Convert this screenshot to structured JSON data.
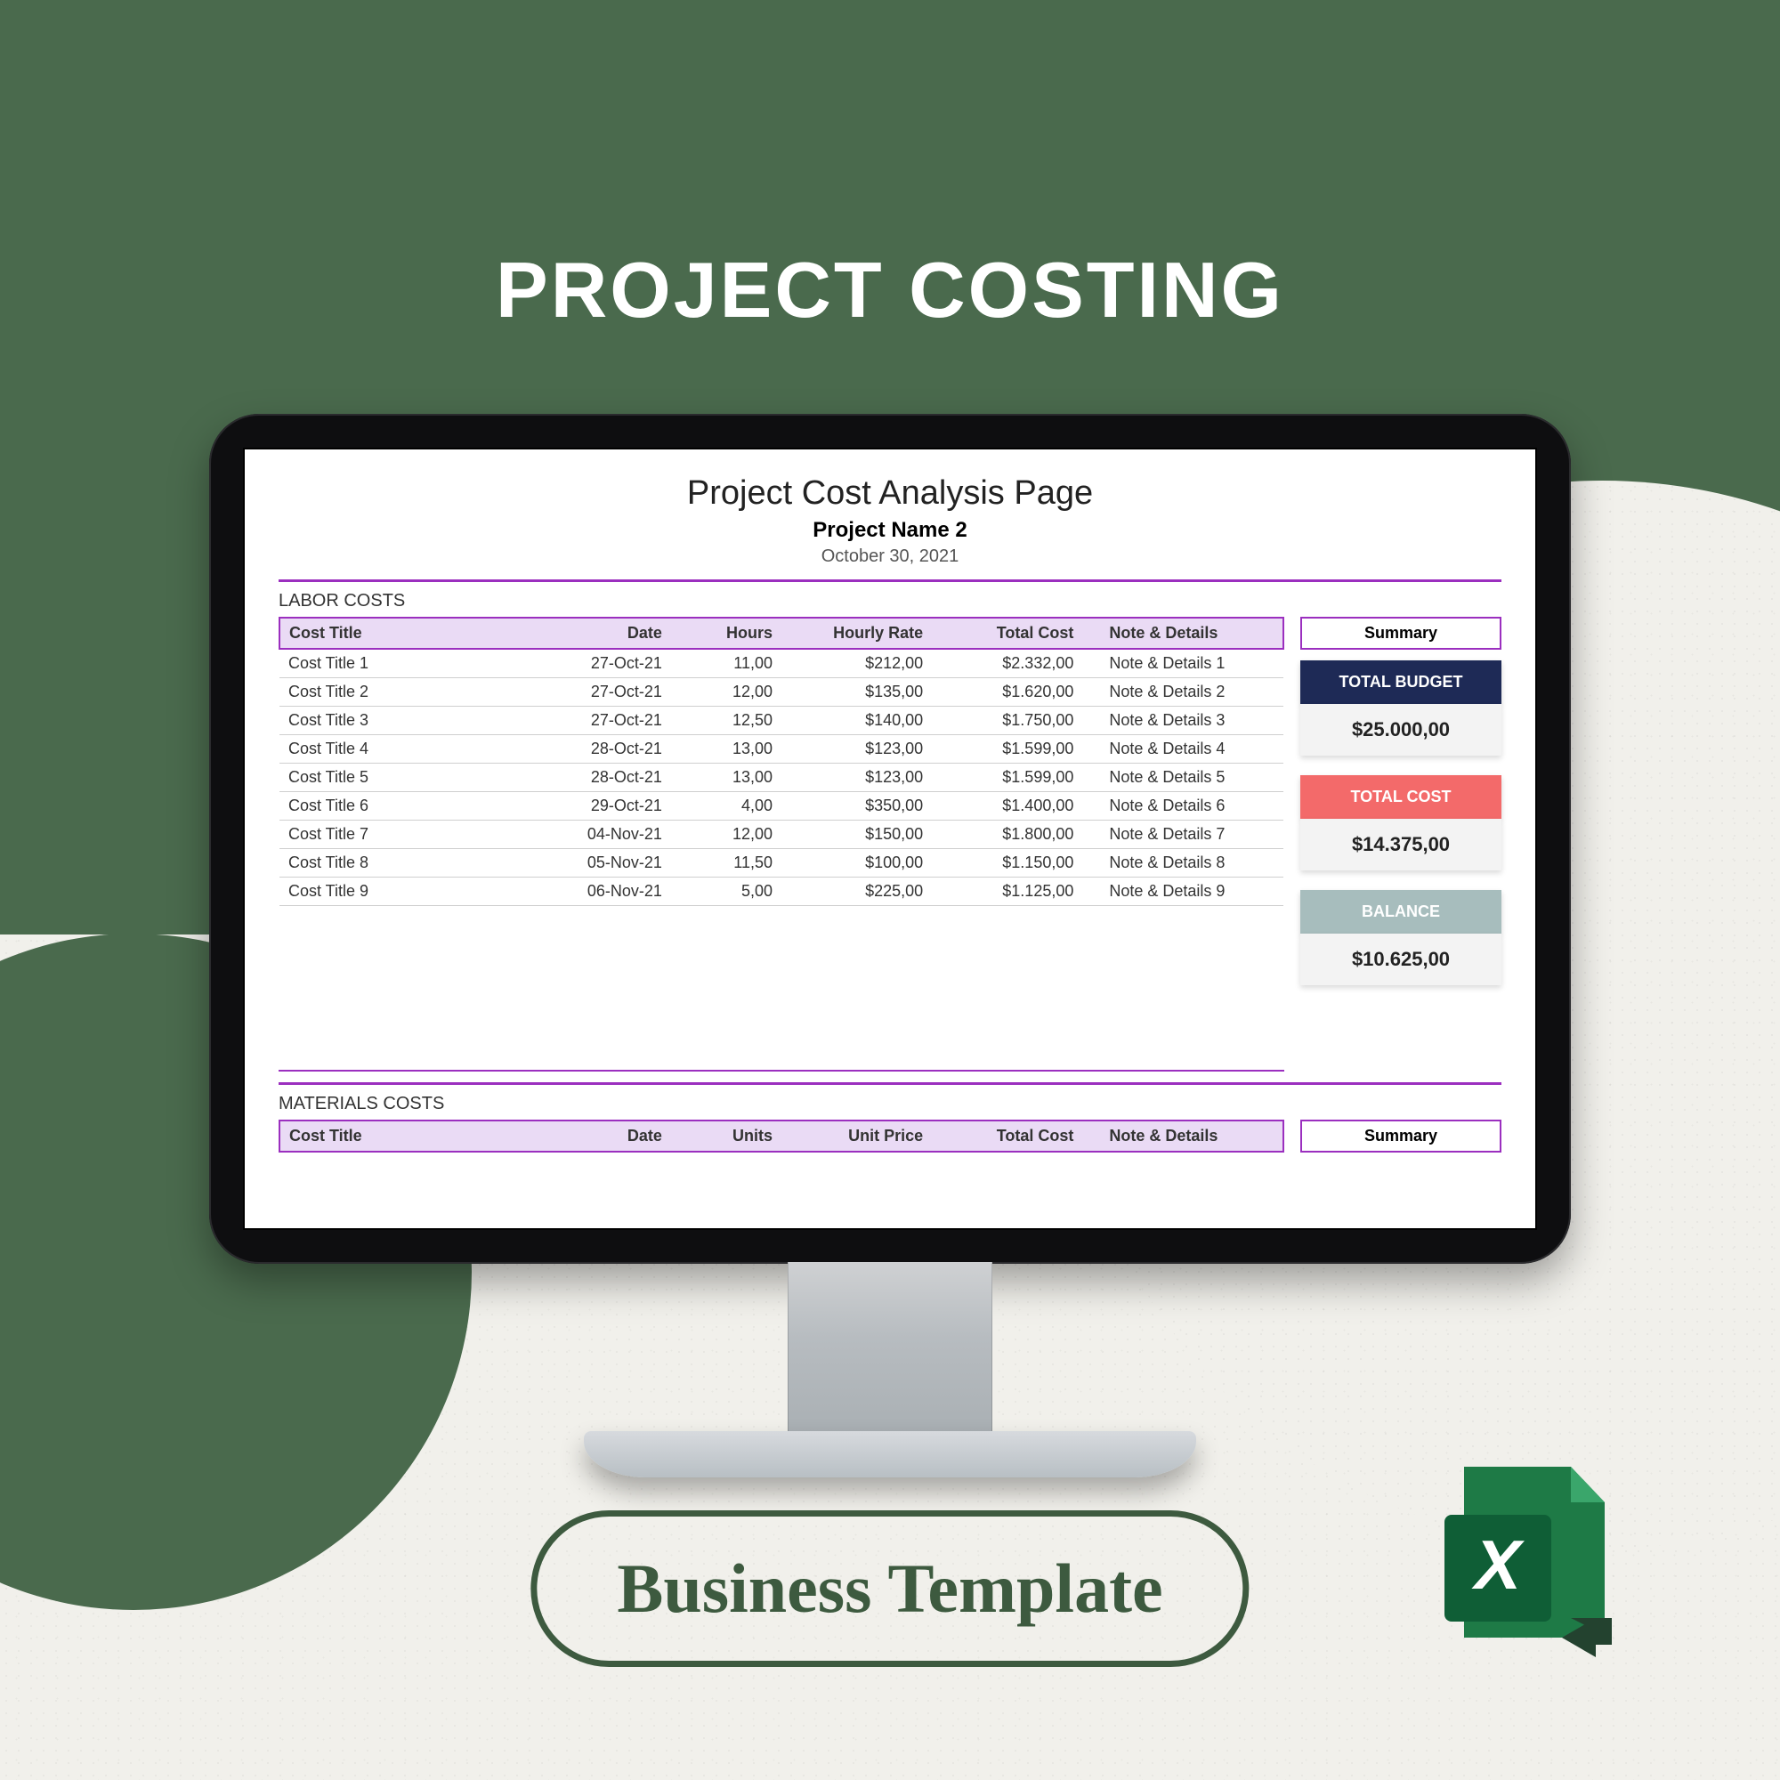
{
  "heading": "PROJECT COSTING",
  "pill_label": "Business Template",
  "doc": {
    "title": "Project Cost Analysis Page",
    "project_name": "Project Name 2",
    "date": "October 30, 2021"
  },
  "labor": {
    "section_label": "LABOR COSTS",
    "headers": {
      "title": "Cost Title",
      "date": "Date",
      "hours": "Hours",
      "rate": "Hourly Rate",
      "total": "Total Cost",
      "note": "Note & Details"
    },
    "rows": [
      {
        "title": "Cost Title 1",
        "date": "27-Oct-21",
        "hours": "11,00",
        "rate": "$212,00",
        "total": "$2.332,00",
        "note": "Note & Details 1"
      },
      {
        "title": "Cost Title 2",
        "date": "27-Oct-21",
        "hours": "12,00",
        "rate": "$135,00",
        "total": "$1.620,00",
        "note": "Note & Details 2"
      },
      {
        "title": "Cost Title 3",
        "date": "27-Oct-21",
        "hours": "12,50",
        "rate": "$140,00",
        "total": "$1.750,00",
        "note": "Note & Details 3"
      },
      {
        "title": "Cost Title 4",
        "date": "28-Oct-21",
        "hours": "13,00",
        "rate": "$123,00",
        "total": "$1.599,00",
        "note": "Note & Details 4"
      },
      {
        "title": "Cost Title 5",
        "date": "28-Oct-21",
        "hours": "13,00",
        "rate": "$123,00",
        "total": "$1.599,00",
        "note": "Note & Details 5"
      },
      {
        "title": "Cost Title 6",
        "date": "29-Oct-21",
        "hours": "4,00",
        "rate": "$350,00",
        "total": "$1.400,00",
        "note": "Note & Details 6"
      },
      {
        "title": "Cost Title 7",
        "date": "04-Nov-21",
        "hours": "12,00",
        "rate": "$150,00",
        "total": "$1.800,00",
        "note": "Note & Details 7"
      },
      {
        "title": "Cost Title 8",
        "date": "05-Nov-21",
        "hours": "11,50",
        "rate": "$100,00",
        "total": "$1.150,00",
        "note": "Note & Details 8"
      },
      {
        "title": "Cost Title 9",
        "date": "06-Nov-21",
        "hours": "5,00",
        "rate": "$225,00",
        "total": "$1.125,00",
        "note": "Note & Details 9"
      }
    ]
  },
  "materials": {
    "section_label": "MATERIALS COSTS",
    "headers": {
      "title": "Cost Title",
      "date": "Date",
      "units": "Units",
      "price": "Unit Price",
      "total": "Total Cost",
      "note": "Note & Details"
    }
  },
  "summary": {
    "header": "Summary",
    "budget_label": "TOTAL BUDGET",
    "budget_value": "$25.000,00",
    "cost_label": "TOTAL COST",
    "cost_value": "$14.375,00",
    "balance_label": "BALANCE",
    "balance_value": "$10.625,00",
    "footer": "Summary"
  },
  "colors": {
    "green": "#4a6a4d",
    "purple": "#9b2fbf",
    "budget": "#1e2a56",
    "cost": "#f36a6a",
    "balance": "#a7bdbd"
  }
}
